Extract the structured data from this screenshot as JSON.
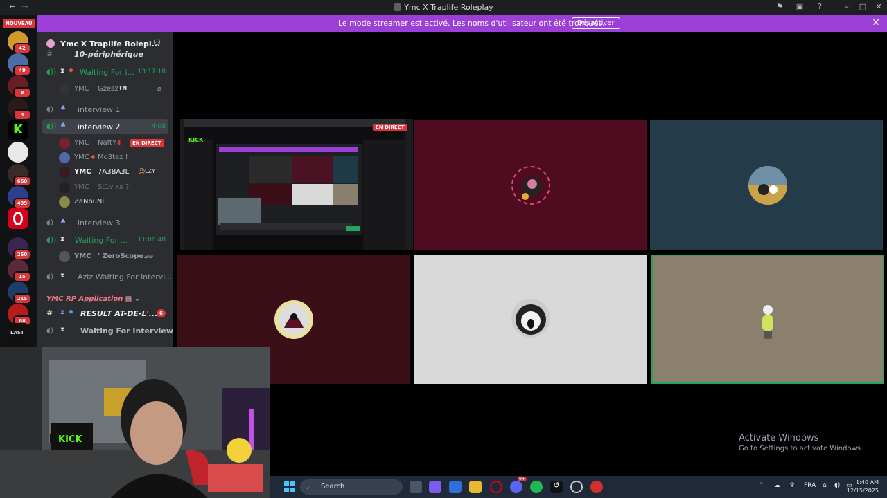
{
  "window": {
    "title": "Ymc X Traplife Roleplay"
  },
  "rail": {
    "nouveau": "NOUVEAU",
    "badges": [
      "42",
      "49",
      "8",
      "3",
      "660",
      "499",
      "250",
      "15",
      "215",
      "68"
    ],
    "last_label": "LAST"
  },
  "banner": {
    "message": "Le mode streamer est activé. Les noms d'utilisateur ont été tronqués.",
    "button": "Désactiver"
  },
  "server": {
    "name": "Ymc X Traplife Rolepl..."
  },
  "channels": {
    "peripherique": "10-périphérique",
    "waiting1": {
      "label": "Waiting For i...",
      "timer": "13:17:18"
    },
    "waiting1_member": {
      "tag": "YMC",
      "nick": "Gzezz",
      "extra": "TN"
    },
    "interview1": "interview 1",
    "interview2": {
      "label": "interview 2",
      "timer": "4:08"
    },
    "interview2_members": [
      {
        "tag": "YMC",
        "nick": "NaftY",
        "live": "EN DIRECT"
      },
      {
        "tag": "YMC",
        "nick": "Mo3taz !"
      },
      {
        "tag": "YMC",
        "nick": "7A3BA3L",
        "extra": "LZY"
      },
      {
        "tag": "YMC",
        "nick": "St1v.xx ?"
      },
      {
        "tag": "",
        "nick": "ZaNouNi"
      }
    ],
    "interview3": "interview 3",
    "waiting2": {
      "label": "Waiting For ...",
      "timer": "11:08:48"
    },
    "waiting2_member": {
      "tag": "YMC",
      "nick": "' ZeroScope..."
    },
    "aziz": "Aziz Waiting For intervi...",
    "category": "YMC RP Application",
    "result": {
      "label": "RESULT AT-DE-L'...",
      "count": "6"
    },
    "waiting3": "Waiting For Interview"
  },
  "stage": {
    "live_tag": "EN DIRECT",
    "kick_logo": "KICK"
  },
  "webcam": {
    "sign": "KICK"
  },
  "taskbar": {
    "search": "Search",
    "lang": "FRA",
    "time": "1:40 AM",
    "date": "12/15/2025",
    "discord_badge": "9+"
  },
  "watermark": {
    "line1": "Activate Windows",
    "line2": "Go to Settings to activate Windows."
  },
  "colors": {
    "banner": "#9c3fd6",
    "live": "#da373c",
    "speaking": "#23a55a"
  }
}
